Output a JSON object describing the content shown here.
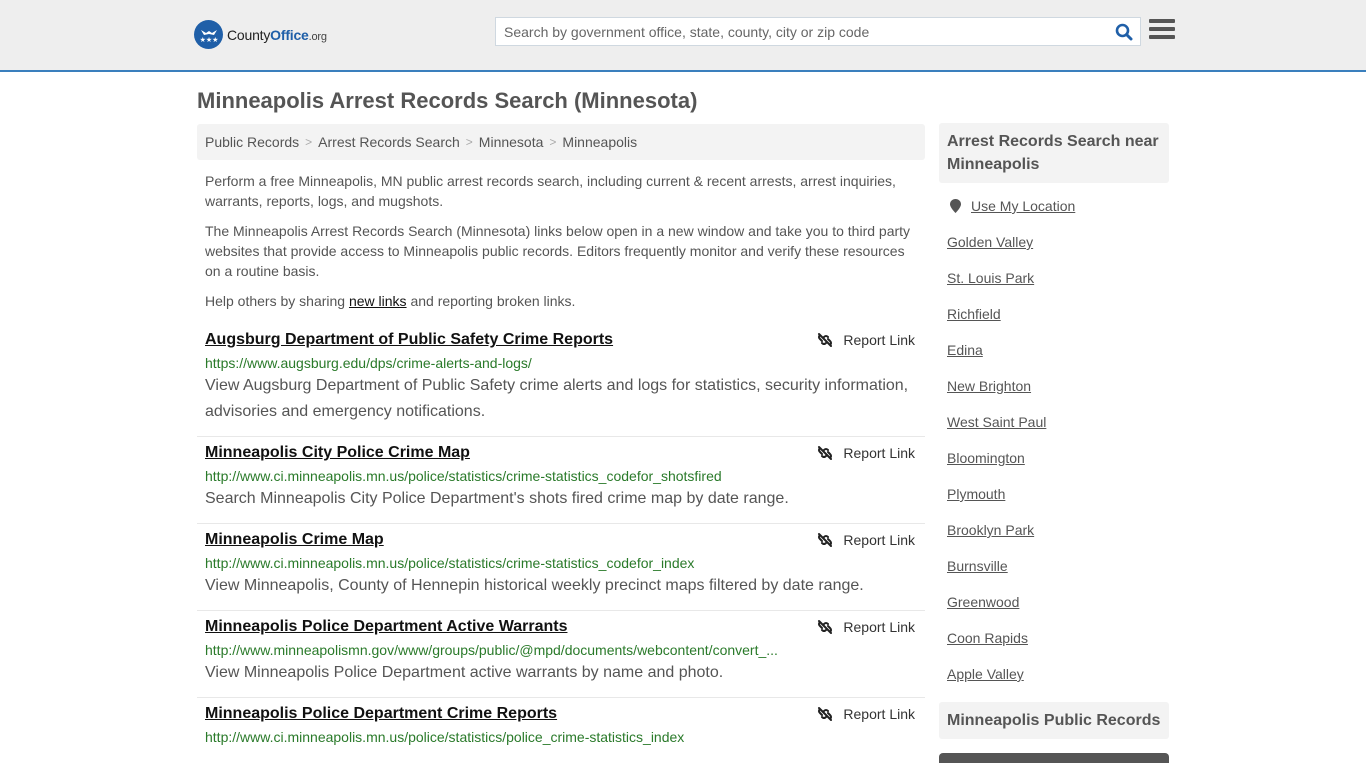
{
  "header": {
    "logo": {
      "county": "County",
      "office": "Office",
      "org": ".org"
    },
    "search_placeholder": "Search by government office, state, county, city or zip code",
    "accent_color": "#3a7fbd"
  },
  "page_title": "Minneapolis Arrest Records Search (Minnesota)",
  "breadcrumb": [
    "Public Records",
    "Arrest Records Search",
    "Minnesota",
    "Minneapolis"
  ],
  "intro": {
    "p1": "Perform a free Minneapolis, MN public arrest records search, including current & recent arrests, arrest inquiries, warrants, reports, logs, and mugshots.",
    "p2": "The Minneapolis Arrest Records Search (Minnesota) links below open in a new window and take you to third party websites that provide access to Minneapolis public records. Editors frequently monitor and verify these resources on a routine basis.",
    "p3_before": "Help others by sharing ",
    "p3_link": "new links",
    "p3_after": " and reporting broken links."
  },
  "report_label": "Report Link",
  "results": [
    {
      "title": "Augsburg Department of Public Safety Crime Reports",
      "url": "https://www.augsburg.edu/dps/crime-alerts-and-logs/",
      "desc": "View Augsburg Department of Public Safety crime alerts and logs for statistics, security information, advisories and emergency notifications."
    },
    {
      "title": "Minneapolis City Police Crime Map",
      "url": "http://www.ci.minneapolis.mn.us/police/statistics/crime-statistics_codefor_shotsfired",
      "desc": "Search Minneapolis City Police Department's shots fired crime map by date range."
    },
    {
      "title": "Minneapolis Crime Map",
      "url": "http://www.ci.minneapolis.mn.us/police/statistics/crime-statistics_codefor_index",
      "desc": "View Minneapolis, County of Hennepin historical weekly precinct maps filtered by date range."
    },
    {
      "title": "Minneapolis Police Department Active Warrants",
      "url": "http://www.minneapolismn.gov/www/groups/public/@mpd/documents/webcontent/convert_...",
      "desc": "View Minneapolis Police Department active warrants by name and photo."
    },
    {
      "title": "Minneapolis Police Department Crime Reports",
      "url": "http://www.ci.minneapolis.mn.us/police/statistics/police_crime-statistics_index",
      "desc": ""
    }
  ],
  "sidebar": {
    "heading": "Arrest Records Search near Minneapolis",
    "use_location": "Use My Location",
    "cities": [
      "Golden Valley",
      "St. Louis Park",
      "Richfield",
      "Edina",
      "New Brighton",
      "West Saint Paul",
      "Bloomington",
      "Plymouth",
      "Brooklyn Park",
      "Burnsville",
      "Greenwood",
      "Coon Rapids",
      "Apple Valley"
    ],
    "heading2": "Minneapolis Public Records"
  }
}
